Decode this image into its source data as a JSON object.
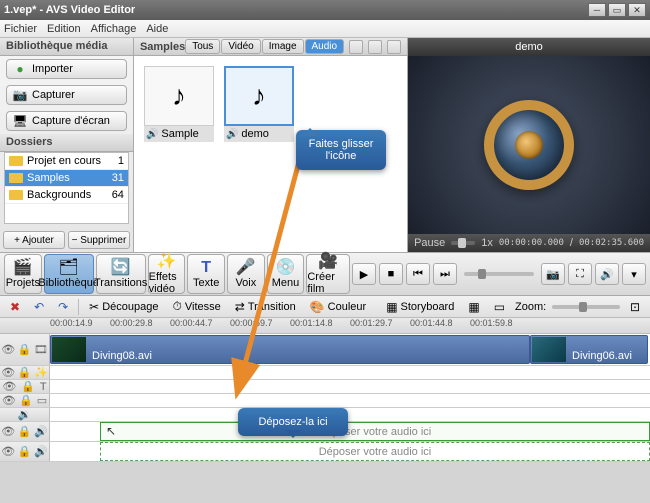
{
  "window": {
    "title": "1.vep* - AVS Video Editor"
  },
  "menu": [
    "Fichier",
    "Edition",
    "Affichage",
    "Aide"
  ],
  "sidebar": {
    "header": "Bibliothèque média",
    "import_btn": "Importer",
    "capture_btn": "Capturer",
    "screencap_btn": "Capture d'écran",
    "dossiers_header": "Dossiers",
    "folders": [
      {
        "name": "Projet en cours",
        "count": "1"
      },
      {
        "name": "Samples",
        "count": "31"
      },
      {
        "name": "Backgrounds",
        "count": "64"
      }
    ],
    "add_btn": "+ Ajouter",
    "del_btn": "− Supprimer"
  },
  "media": {
    "title": "Samples",
    "filters": [
      "Tous",
      "Vidéo",
      "Image",
      "Audio"
    ],
    "active_filter": "Audio",
    "items": [
      {
        "name": "Sample"
      },
      {
        "name": "demo"
      }
    ]
  },
  "preview": {
    "title": "demo",
    "status": "Pause",
    "speed": "1x",
    "elapsed": "00:00:00.000",
    "total": "00:02:35.600"
  },
  "toolbar": {
    "projets": "Projets",
    "biblio": "Bibliothèque",
    "transitions": "Transitions",
    "effets": "Effets vidéo",
    "texte": "Texte",
    "voix": "Voix",
    "menu": "Menu",
    "creer": "Créer film"
  },
  "edit_toolbar": {
    "decoupage": "Découpage",
    "vitesse": "Vitesse",
    "transition": "Transition",
    "couleur": "Couleur",
    "storyboard": "Storyboard",
    "zoom": "Zoom:"
  },
  "timeline": {
    "marks": [
      "00:00:14.9",
      "00:00:29.8",
      "00:00:44.7",
      "00:00:59.7",
      "00:01:14.8",
      "00:01:29.7",
      "00:01:44.8",
      "00:01:59.8"
    ],
    "clip1": "Diving08.avi",
    "clip2": "Diving06.avi",
    "drop_hint": "Déposer votre audio ici"
  },
  "tooltips": {
    "drag": "Faites glisser l'icône",
    "drop": "Déposez-la ici"
  }
}
